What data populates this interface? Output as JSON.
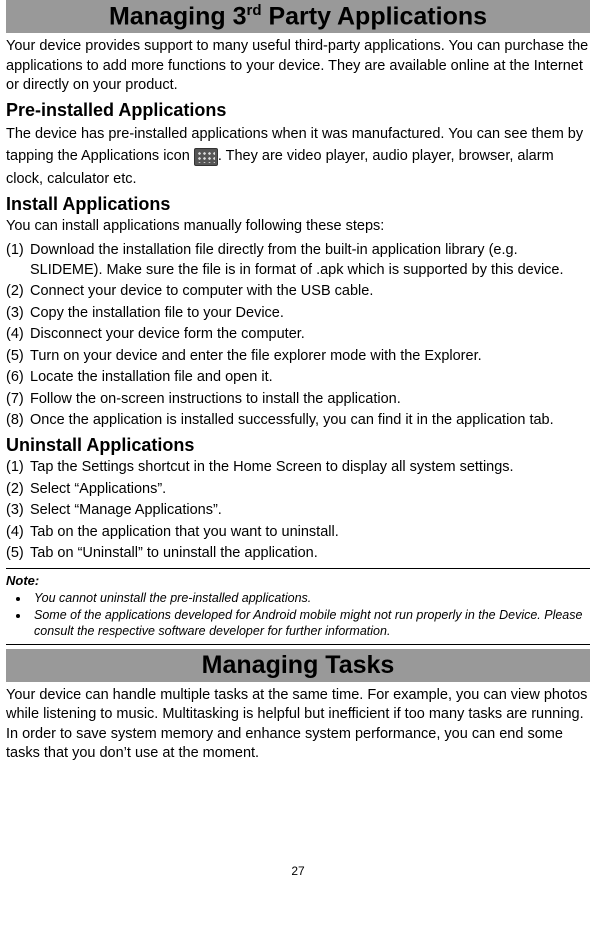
{
  "header1": {
    "pre": "Managing 3",
    "sup": "rd",
    "post": " Party Applications"
  },
  "intro1": "Your device provides support to many useful third-party applications. You can purchase the applications to add more functions to your device. They are available online at the Internet or directly on your product.",
  "preinstalled": {
    "heading": "Pre-installed Applications",
    "text_before_icon": "The device has pre-installed applications when it was manufactured. You can see them by tapping the Applications icon ",
    "text_after_icon": ". They are video player, audio player, browser, alarm clock, calculator etc."
  },
  "install": {
    "heading": "Install Applications",
    "intro": "You can install applications manually following these steps:",
    "steps": [
      "Download the installation file directly from the built-in application library (e.g. SLIDEME). Make sure the file is in format of .apk which is supported by this device.",
      "Connect your device to computer with the USB cable.",
      "Copy the installation file to your Device.",
      "Disconnect your device form the computer.",
      "Turn on your device and enter the file explorer mode with the Explorer.",
      "Locate the installation file and open it.",
      "Follow the on-screen instructions to install the application.",
      "Once the application is installed successfully, you can find it in the application tab."
    ]
  },
  "uninstall": {
    "heading": "Uninstall Applications",
    "steps": [
      "Tap the Settings shortcut in the Home Screen to display all system settings.",
      "Select “Applications”.",
      "Select “Manage Applications”.",
      "Tab on the application that you want to uninstall.",
      "Tab on “Uninstall” to uninstall the application."
    ]
  },
  "note": {
    "heading": "Note:",
    "items": [
      "You cannot uninstall the pre-installed applications.",
      "Some of the applications developed for Android mobile might not run properly in the Device. Please consult the respective software developer for further information."
    ]
  },
  "header2": "Managing Tasks",
  "intro2": "Your device can handle multiple tasks at the same time. For example, you can view photos while listening to music. Multitasking is helpful but inefficient if too many tasks are running. In order to save system memory and enhance system performance, you can end some tasks that you don’t use at the moment.",
  "page_number": "27"
}
